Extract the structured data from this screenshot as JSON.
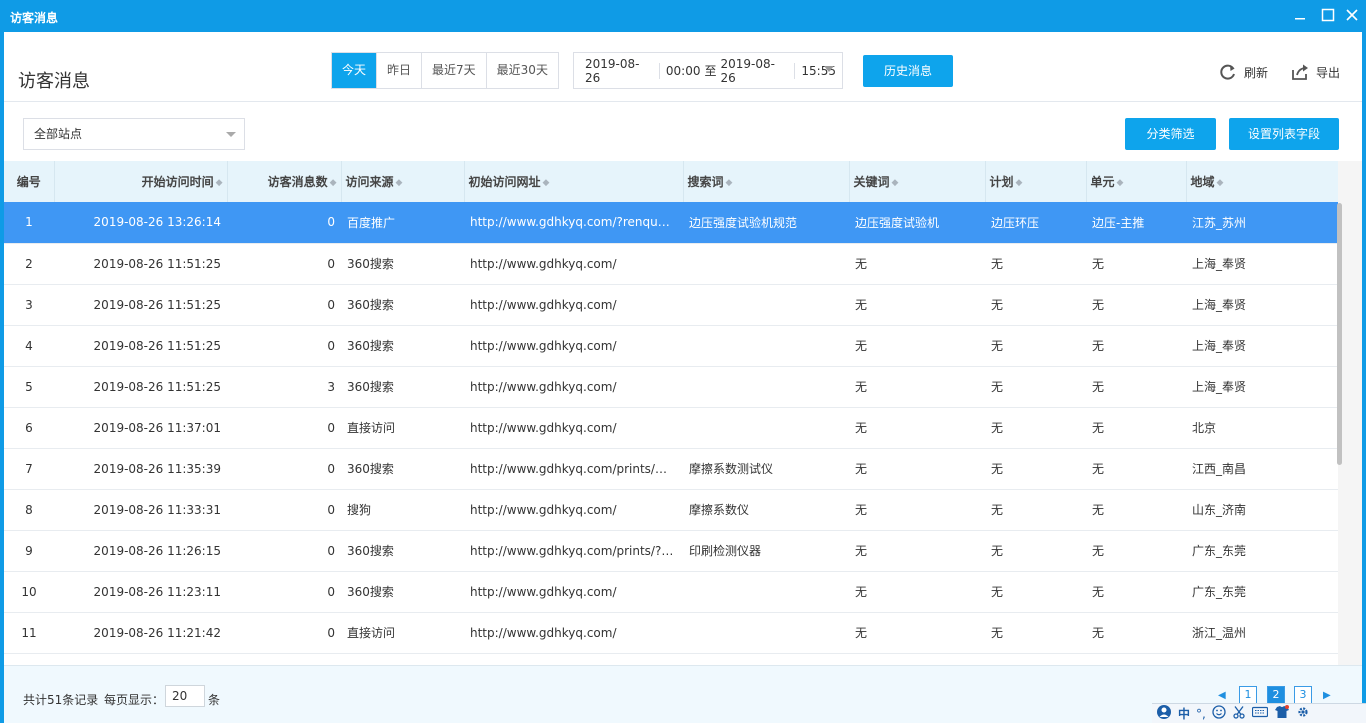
{
  "window": {
    "title": "访客消息"
  },
  "header": {
    "page_title": "访客消息",
    "range_tabs": [
      {
        "label": "今天",
        "active": true
      },
      {
        "label": "昨日",
        "active": false
      },
      {
        "label": "最近7天",
        "active": false
      },
      {
        "label": "最近30天",
        "active": false
      }
    ],
    "date_range": {
      "start_date": "2019-08-26",
      "start_time": "00:00",
      "separator": "至",
      "end_date": "2019-08-26",
      "end_time": "15:55"
    },
    "history_button": "历史消息",
    "refresh_label": "刷新",
    "export_label": "导出"
  },
  "filter": {
    "site_select_value": "全部站点",
    "category_button": "分类筛选",
    "fields_button": "设置列表字段"
  },
  "table": {
    "columns": [
      "编号",
      "开始访问时间",
      "访客消息数",
      "访问来源",
      "初始访问网址",
      "搜索词",
      "关键词",
      "计划",
      "单元",
      "地域"
    ],
    "rows": [
      {
        "no": "1",
        "time": "2019-08-26 13:26:14",
        "msgs": "0",
        "source": "百度推广",
        "url": "http://www.gdhkyq.com/?renqun_...",
        "search": "边压强度试验机规范",
        "keyword": "边压强度试验机",
        "plan": "边压环压",
        "unit": "边压-主推",
        "region": "江苏_苏州",
        "selected": true
      },
      {
        "no": "2",
        "time": "2019-08-26 11:51:25",
        "msgs": "0",
        "source": "360搜索",
        "url": "http://www.gdhkyq.com/",
        "search": "",
        "keyword": "无",
        "plan": "无",
        "unit": "无",
        "region": "上海_奉贤"
      },
      {
        "no": "3",
        "time": "2019-08-26 11:51:25",
        "msgs": "0",
        "source": "360搜索",
        "url": "http://www.gdhkyq.com/",
        "search": "",
        "keyword": "无",
        "plan": "无",
        "unit": "无",
        "region": "上海_奉贤"
      },
      {
        "no": "4",
        "time": "2019-08-26 11:51:25",
        "msgs": "0",
        "source": "360搜索",
        "url": "http://www.gdhkyq.com/",
        "search": "",
        "keyword": "无",
        "plan": "无",
        "unit": "无",
        "region": "上海_奉贤"
      },
      {
        "no": "5",
        "time": "2019-08-26 11:51:25",
        "msgs": "3",
        "source": "360搜索",
        "url": "http://www.gdhkyq.com/",
        "search": "",
        "keyword": "无",
        "plan": "无",
        "unit": "无",
        "region": "上海_奉贤"
      },
      {
        "no": "6",
        "time": "2019-08-26 11:37:01",
        "msgs": "0",
        "source": "直接访问",
        "url": "http://www.gdhkyq.com/",
        "search": "",
        "keyword": "无",
        "plan": "无",
        "unit": "无",
        "region": "北京"
      },
      {
        "no": "7",
        "time": "2019-08-26 11:35:39",
        "msgs": "0",
        "source": "360搜索",
        "url": "http://www.gdhkyq.com/prints/m...",
        "search": "摩擦系数测试仪",
        "keyword": "无",
        "plan": "无",
        "unit": "无",
        "region": "江西_南昌"
      },
      {
        "no": "8",
        "time": "2019-08-26 11:33:31",
        "msgs": "0",
        "source": "搜狗",
        "url": "http://www.gdhkyq.com/",
        "search": "摩擦系数仪",
        "keyword": "无",
        "plan": "无",
        "unit": "无",
        "region": "山东_济南"
      },
      {
        "no": "9",
        "time": "2019-08-26 11:26:15",
        "msgs": "0",
        "source": "360搜索",
        "url": "http://www.gdhkyq.com/prints/?3...",
        "search": "印刷检测仪器",
        "keyword": "无",
        "plan": "无",
        "unit": "无",
        "region": "广东_东莞"
      },
      {
        "no": "10",
        "time": "2019-08-26 11:23:11",
        "msgs": "0",
        "source": "360搜索",
        "url": "http://www.gdhkyq.com/",
        "search": "",
        "keyword": "无",
        "plan": "无",
        "unit": "无",
        "region": "广东_东莞"
      },
      {
        "no": "11",
        "time": "2019-08-26 11:21:42",
        "msgs": "0",
        "source": "直接访问",
        "url": "http://www.gdhkyq.com/",
        "search": "",
        "keyword": "无",
        "plan": "无",
        "unit": "无",
        "region": "浙江_温州"
      }
    ]
  },
  "footer": {
    "total_label": "共计51条记录",
    "per_page_label": "每页显示：",
    "per_page_value": "20",
    "per_page_unit": "条",
    "pages": [
      "1",
      "2",
      "3"
    ],
    "current_page": "2"
  },
  "ime": {
    "mode": "中",
    "punct": "°,"
  },
  "colors": {
    "titlebar": "#0f9be6",
    "accent": "#0ea4ec",
    "selected_row": "#3f97f4",
    "header_bg": "#e6f4fb"
  }
}
